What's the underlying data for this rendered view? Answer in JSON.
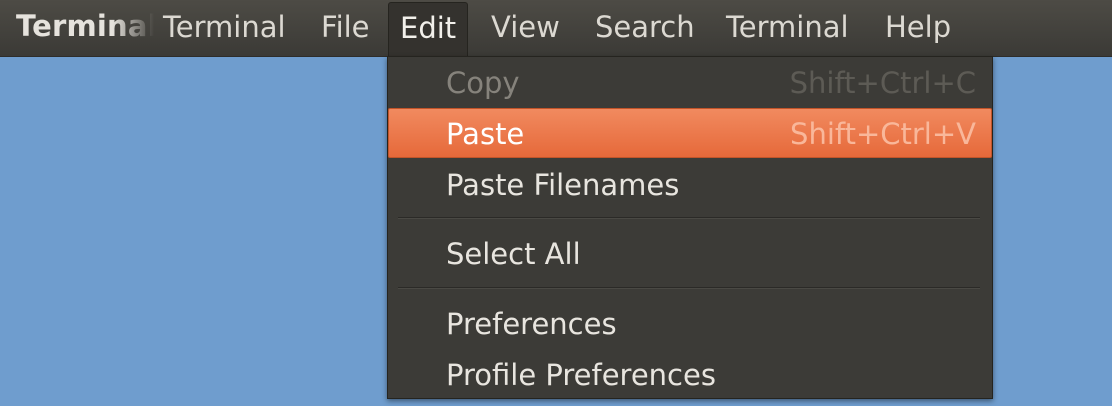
{
  "menubar": {
    "app_title": "Terminal",
    "menus": [
      "Terminal",
      "File",
      "Edit",
      "View",
      "Search",
      "Terminal",
      "Help"
    ]
  },
  "edit_menu": {
    "items": [
      {
        "label": "Copy",
        "accel": "Shift+Ctrl+C",
        "state": "disabled"
      },
      {
        "label": "Paste",
        "accel": "Shift+Ctrl+V",
        "state": "highlighted"
      },
      {
        "label": "Paste Filenames",
        "accel": "",
        "state": "normal"
      },
      {
        "label": "Select All",
        "accel": "",
        "state": "normal"
      },
      {
        "label": "Preferences",
        "accel": "",
        "state": "normal"
      },
      {
        "label": "Profile Preferences",
        "accel": "",
        "state": "normal"
      }
    ]
  },
  "colors": {
    "desktop": "#6f9dce",
    "menubar": "#3c3b37",
    "highlight": "#e6693a"
  }
}
